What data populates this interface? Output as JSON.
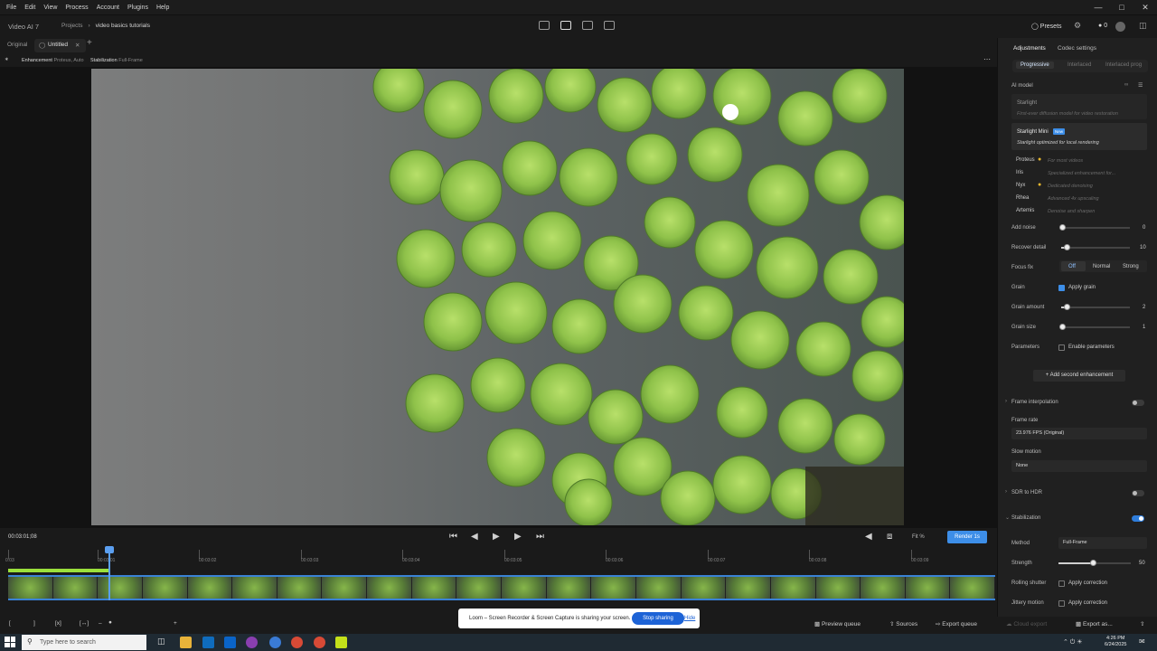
{
  "menu": [
    "File",
    "Edit",
    "View",
    "Process",
    "Account",
    "Plugins",
    "Help"
  ],
  "app": {
    "title": "Video AI 7",
    "breadcrumb_root": "Projects",
    "breadcrumb_current": "video basics tutorials",
    "presets_label": "Presets",
    "credits": "0"
  },
  "tabs": {
    "original": "Original",
    "untitled": "Untitled",
    "add": "+"
  },
  "status": {
    "enh_key": "Enhancement",
    "enh_val": "Proteus, Auto",
    "stab_key": "Stabilization",
    "stab_val": "Full-Frame"
  },
  "transport": {
    "timecode": "00:03:01;08",
    "fit_label": "Fit %",
    "render_label": "Render 1s"
  },
  "ruler": [
    "0:03",
    "00:03:01",
    "00:03:02",
    "00:03:03",
    "00:03:04",
    "00:03:05",
    "00:03:06",
    "00:03:07",
    "00:03:08",
    "00:03:09"
  ],
  "bottom": {
    "preview_queue": "Preview queue",
    "sources": "Sources",
    "export_queue": "Export queue",
    "cloud_export": "Cloud export",
    "export_as": "Export as..."
  },
  "loom": {
    "message": "Loom – Screen Recorder & Screen Capture is sharing your screen.",
    "stop": "Stop sharing",
    "hide": "Hide"
  },
  "taskbar": {
    "search_placeholder": "Type here to search",
    "time": "4:26 PM",
    "date": "6/24/2025"
  },
  "panel": {
    "tab_adjustments": "Adjustments",
    "tab_codec": "Codec settings",
    "mode_progressive": "Progressive",
    "mode_interlaced": "Interlaced",
    "mode_interlaced_prog": "Interlaced prog",
    "ai_model_label": "AI model",
    "models": [
      {
        "name": "Starlight",
        "desc": "First-ever diffusion model for video restoration"
      },
      {
        "name": "Starlight Mini",
        "badge": "New",
        "desc": "Starlight optimized for local rendering"
      },
      {
        "name": "Proteus",
        "desc": "For most videos"
      },
      {
        "name": "Iris",
        "desc": "Specialized enhancement for..."
      },
      {
        "name": "Nyx",
        "desc": "Dedicated denoising"
      },
      {
        "name": "Rhea",
        "desc": "Advanced 4x upscaling"
      },
      {
        "name": "Artemis",
        "desc": "Denoise and sharpen"
      }
    ],
    "add_noise_label": "Add noise",
    "add_noise_value": "0",
    "recover_detail_label": "Recover detail",
    "recover_detail_value": "10",
    "focus_fix_label": "Focus fix",
    "focus_off": "Off",
    "focus_normal": "Normal",
    "focus_strong": "Strong",
    "grain_label": "Grain",
    "apply_grain": "Apply grain",
    "grain_amount_label": "Grain amount",
    "grain_amount_value": "2",
    "grain_size_label": "Grain size",
    "grain_size_value": "1",
    "parameters_label": "Parameters",
    "enable_parameters": "Enable parameters",
    "add_second": "Add second enhancement",
    "frame_interp_label": "Frame interpolation",
    "frame_rate_label": "Frame rate",
    "frame_rate_value": "23.976 FPS (Original)",
    "slow_motion_label": "Slow motion",
    "slow_motion_value": "None",
    "sdr_hdr_label": "SDR to HDR",
    "stabilization_label": "Stabilization",
    "method_label": "Method",
    "method_value": "Full-Frame",
    "strength_label": "Strength",
    "strength_value": "50",
    "rolling_label": "Rolling shutter",
    "apply_correction": "Apply correction",
    "jittery_label": "Jittery motion",
    "apply_correction2": "Apply correction"
  },
  "colors": {
    "accent": "#3d8ee8",
    "timeline_progress": "#9be03c",
    "bg": "#1a1a1a"
  }
}
